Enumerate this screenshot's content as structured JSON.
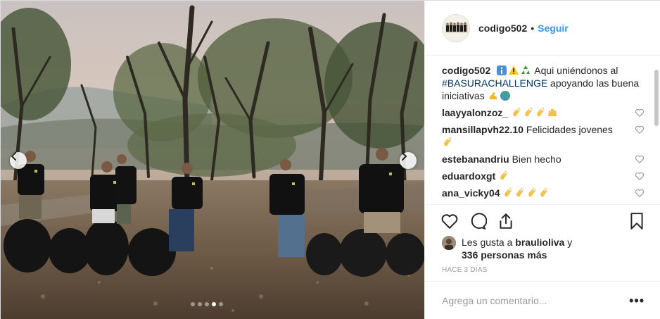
{
  "post": {
    "username": "codigo502",
    "follow_label": "Seguir",
    "separator": "•",
    "caption": {
      "username": "codigo502",
      "text_before": " Aqui uniéndonos al ",
      "hashtag": "#BASURACHALLENGE",
      "text_after": " apoyando las buena iniciativas",
      "emojis_pre": [
        "info-icon",
        "warning-icon",
        "recycle-icon"
      ],
      "emojis_post": [
        "flexed-biceps-icon",
        "globe-icon"
      ]
    },
    "comments": [
      {
        "username": "laayyalonzoz_",
        "text": "",
        "emojis": [
          "clapping-hands",
          "clapping-hands",
          "clapping-hands",
          "raising-hands"
        ]
      },
      {
        "username": "mansillapvh22.10",
        "text": "Felicidades jovenes",
        "emojis": [
          "clapping-hands"
        ]
      },
      {
        "username": "estebanandriu",
        "text": "Bien hecho",
        "emojis": []
      },
      {
        "username": "eduardoxgt",
        "text": "",
        "emojis": [
          "clapping-hands"
        ]
      },
      {
        "username": "ana_vicky04",
        "text": "",
        "emojis": [
          "clapping-hands",
          "clapping-hands",
          "clapping-hands",
          "clapping-hands"
        ]
      }
    ],
    "likes": {
      "prefix": "Les gusta a ",
      "user": "braulioliva",
      "middle": " y",
      "count_text": "336 personas más"
    },
    "time": "HACE 3 DÍAS",
    "comment_placeholder": "Agrega un comentario...",
    "more_label": "•••",
    "carousel": {
      "total": 5,
      "active_index": 3
    }
  },
  "colors": {
    "link_blue": "#3897f0",
    "hashtag": "#003569",
    "muted": "#999999",
    "border": "#efefef"
  }
}
